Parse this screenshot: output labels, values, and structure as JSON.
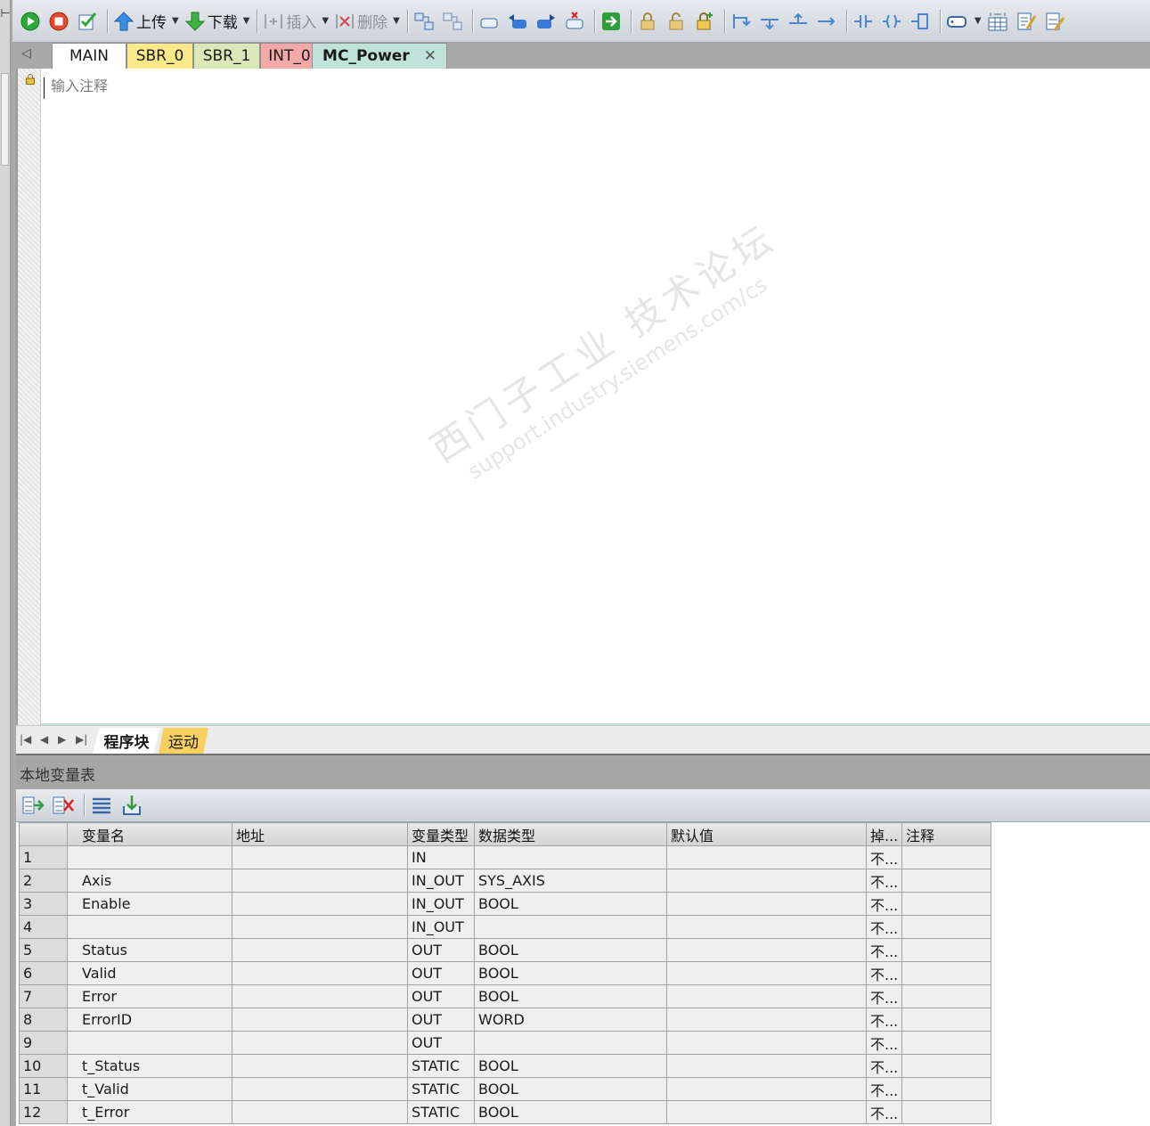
{
  "toolbar": {
    "upload_label": "上传",
    "download_label": "下载",
    "insert_label": "插入",
    "delete_label": "删除"
  },
  "tabs": [
    {
      "label": "MAIN",
      "color": "#ffffff"
    },
    {
      "label": "SBR_0",
      "color": "#fbe88a"
    },
    {
      "label": "SBR_1",
      "color": "#d9e8b8"
    },
    {
      "label": "INT_0",
      "color": "#f5a8a8"
    },
    {
      "label": "MC_Power",
      "color": "#bfe3d8",
      "active": true
    }
  ],
  "tab_close_glyph": "✕",
  "editor": {
    "comment_placeholder": "输入注释"
  },
  "watermark": {
    "line1": "西门子工业 技术论坛",
    "line2": "support.industry.siemens.com/cs"
  },
  "bottom_tabs": [
    {
      "label": "程序块",
      "active": true
    },
    {
      "label": "运动",
      "color": "#f7d060"
    }
  ],
  "var_panel": {
    "title": "本地变量表",
    "columns": [
      "",
      "变量名",
      "地址",
      "变量类型",
      "数据类型",
      "默认值",
      "掉...",
      "注释"
    ],
    "rows": [
      {
        "n": "1",
        "name": "",
        "addr": "",
        "vtype": "IN",
        "dtype": "",
        "default": "",
        "retain": "不...",
        "comment": ""
      },
      {
        "n": "2",
        "name": "Axis",
        "addr": "",
        "vtype": "IN_OUT",
        "dtype": "SYS_AXIS",
        "default": "",
        "retain": "不...",
        "comment": ""
      },
      {
        "n": "3",
        "name": "Enable",
        "addr": "",
        "vtype": "IN_OUT",
        "dtype": "BOOL",
        "default": "",
        "retain": "不...",
        "comment": ""
      },
      {
        "n": "4",
        "name": "",
        "addr": "",
        "vtype": "IN_OUT",
        "dtype": "",
        "default": "",
        "retain": "不...",
        "comment": ""
      },
      {
        "n": "5",
        "name": "Status",
        "addr": "",
        "vtype": "OUT",
        "dtype": "BOOL",
        "default": "",
        "retain": "不...",
        "comment": ""
      },
      {
        "n": "6",
        "name": "Valid",
        "addr": "",
        "vtype": "OUT",
        "dtype": "BOOL",
        "default": "",
        "retain": "不...",
        "comment": ""
      },
      {
        "n": "7",
        "name": "Error",
        "addr": "",
        "vtype": "OUT",
        "dtype": "BOOL",
        "default": "",
        "retain": "不...",
        "comment": ""
      },
      {
        "n": "8",
        "name": "ErrorID",
        "addr": "",
        "vtype": "OUT",
        "dtype": "WORD",
        "default": "",
        "retain": "不...",
        "comment": ""
      },
      {
        "n": "9",
        "name": "",
        "addr": "",
        "vtype": "OUT",
        "dtype": "",
        "default": "",
        "retain": "不...",
        "comment": ""
      },
      {
        "n": "10",
        "name": "t_Status",
        "addr": "",
        "vtype": "STATIC",
        "dtype": "BOOL",
        "default": "",
        "retain": "不...",
        "comment": ""
      },
      {
        "n": "11",
        "name": "t_Valid",
        "addr": "",
        "vtype": "STATIC",
        "dtype": "BOOL",
        "default": "",
        "retain": "不...",
        "comment": ""
      },
      {
        "n": "12",
        "name": "t_Error",
        "addr": "",
        "vtype": "STATIC",
        "dtype": "BOOL",
        "default": "",
        "retain": "不...",
        "comment": ""
      }
    ]
  }
}
